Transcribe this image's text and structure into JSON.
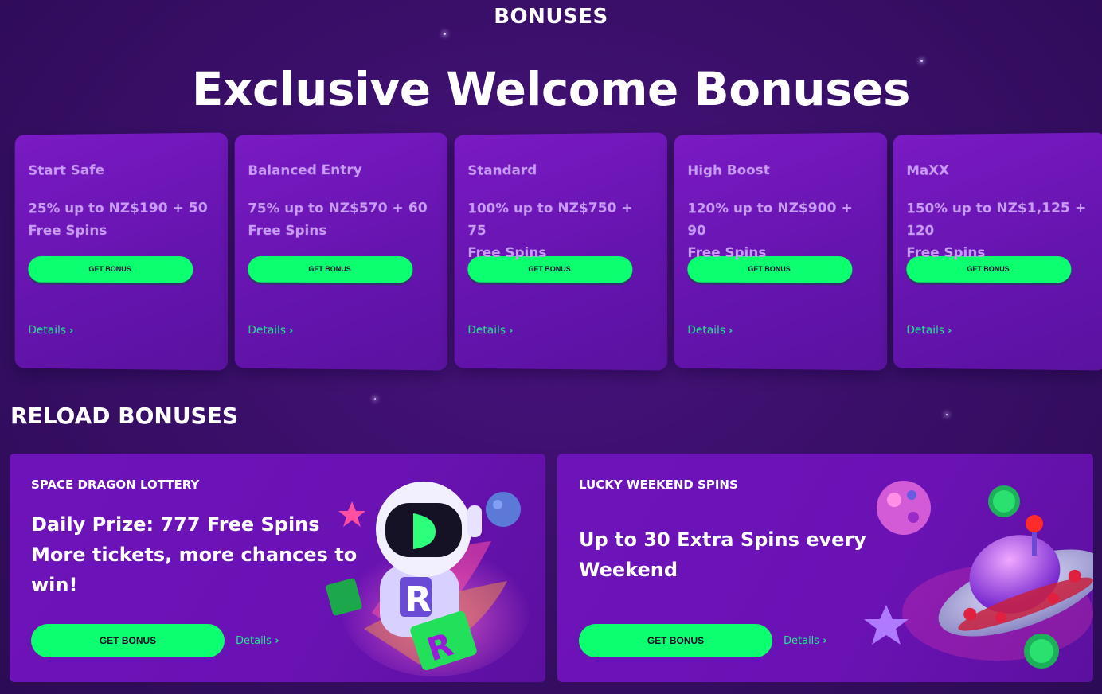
{
  "header": {
    "section_label": "BONUSES",
    "title": "Exclusive Welcome Bonuses"
  },
  "welcome_bonuses": [
    {
      "name": "Start Safe",
      "offer_line1": "25% up to NZ$190 + 50",
      "offer_line2": "Free Spins",
      "button": "GET BONUS",
      "details": "Details"
    },
    {
      "name": "Balanced Entry",
      "offer_line1": "75% up to NZ$570 + 60",
      "offer_line2": "Free Spins",
      "button": "GET BONUS",
      "details": "Details"
    },
    {
      "name": "Standard",
      "offer_line1": "100% up to NZ$750 + 75",
      "offer_line2": "Free Spins",
      "button": "GET BONUS",
      "details": "Details"
    },
    {
      "name": "High Boost",
      "offer_line1": "120% up to NZ$900 + 90",
      "offer_line2": "Free Spins",
      "button": "GET BONUS",
      "details": "Details"
    },
    {
      "name": "MaXX",
      "offer_line1": "150% up to NZ$1,125 + 120",
      "offer_line2": "Free Spins",
      "button": "GET BONUS",
      "details": "Details"
    }
  ],
  "reload": {
    "title": "RELOAD BONUSES",
    "cards": [
      {
        "kicker": "SPACE DRAGON LOTTERY",
        "lines": [
          "Daily Prize: 777 Free Spins",
          "More tickets, more chances to",
          "win!"
        ],
        "button": "GET BONUS",
        "details": "Details",
        "art_icon": "astronaut-robot-illustration"
      },
      {
        "kicker": "LUCKY WEEKEND SPINS",
        "lines": [
          "Up to 30 Extra Spins every",
          "Weekend"
        ],
        "button": "GET BONUS",
        "details": "Details",
        "art_icon": "ufo-planet-illustration"
      }
    ]
  },
  "colors": {
    "background": "#3a0f6a",
    "card": "#6a14b6",
    "accent_green": "#0cff6e",
    "link_green": "#20e88f",
    "muted_card_text": "#c79cf2"
  }
}
